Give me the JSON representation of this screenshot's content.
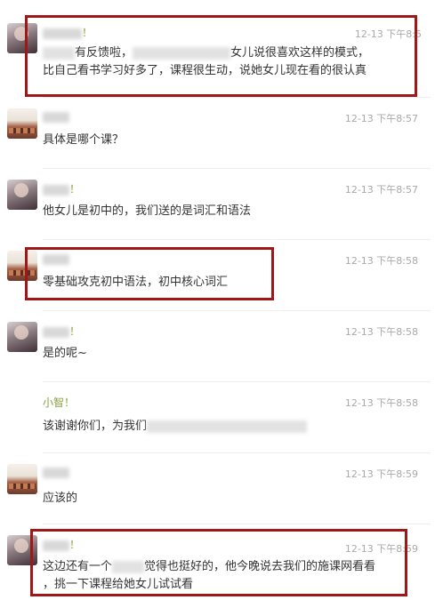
{
  "messages": [
    {
      "name": "",
      "time": "12-13 下午8:5",
      "line1_a": "有反馈啦，",
      "line1_b": "女儿说很喜欢这样的模式，",
      "line2": "比自己看书学习好多了，课程很生动，说她女儿现在看的很认真"
    },
    {
      "name": "",
      "time": "12-13 下午8:57",
      "text": "具体是哪个课？"
    },
    {
      "name": "",
      "time": "12-13 下午8:57",
      "text": "他女儿是初中的，我们送的是词汇和语法"
    },
    {
      "name": "",
      "time": "12-13 下午8:58",
      "text": "零基础攻克初中语法，初中核心词汇"
    },
    {
      "name": "",
      "time": "12-13 下午8:58",
      "text": "是的呢~"
    },
    {
      "name": "小智！",
      "time": "12-13 下午8:58",
      "text": "该谢谢你们，为我们"
    },
    {
      "name": "",
      "time": "12-13 下午8:59",
      "text": "应该的"
    },
    {
      "name": "",
      "time": "12-13 下午8:59",
      "line1_a": "这边还有一个",
      "line1_b": "觉得也挺好的，他今晚说去我们的施课网看看",
      "line2": "，挑一下课程给她女儿试试看"
    }
  ],
  "colors": {
    "highlight": "#a01717",
    "name": "#8aa03f",
    "time": "#a9a9a9",
    "text": "#333333"
  }
}
